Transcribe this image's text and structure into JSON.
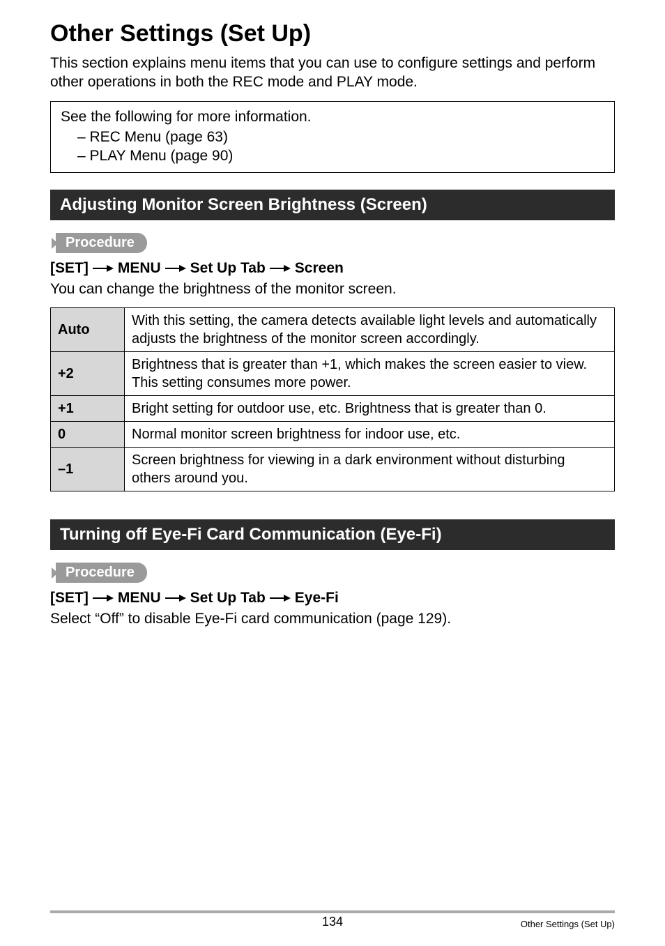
{
  "title": "Other Settings (Set Up)",
  "intro": "This section explains menu items that you can use to configure settings and perform other operations in both the REC mode and PLAY mode.",
  "info_box": {
    "heading": "See the following for more information.",
    "items": [
      "–  REC Menu (page 63)",
      "–  PLAY Menu (page 90)"
    ]
  },
  "procedure_label": "Procedure",
  "section1": {
    "heading": "Adjusting Monitor Screen Brightness (Screen)",
    "path": [
      "[SET]",
      "MENU",
      "Set Up Tab",
      "Screen"
    ],
    "desc": "You can change the brightness of the monitor screen.",
    "table": [
      {
        "key": "Auto",
        "val": "With this setting, the camera detects available light levels and automatically adjusts the brightness of the monitor screen accordingly."
      },
      {
        "key": "+2",
        "val": "Brightness that is greater than +1, which makes the screen easier to view. This setting consumes more power."
      },
      {
        "key": "+1",
        "val": "Bright setting for outdoor use, etc. Brightness that is greater than 0."
      },
      {
        "key": "0",
        "val": "Normal monitor screen brightness for indoor use, etc."
      },
      {
        "key": "–1",
        "val": "Screen brightness for viewing in a dark environment without disturbing others around you."
      }
    ]
  },
  "section2": {
    "heading": "Turning off Eye-Fi Card Communication (Eye-Fi)",
    "path": [
      "[SET]",
      "MENU",
      "Set Up Tab",
      "Eye-Fi"
    ],
    "desc": "Select “Off” to disable Eye-Fi card communication (page 129)."
  },
  "footer": {
    "page": "134",
    "right": "Other Settings (Set Up)"
  }
}
